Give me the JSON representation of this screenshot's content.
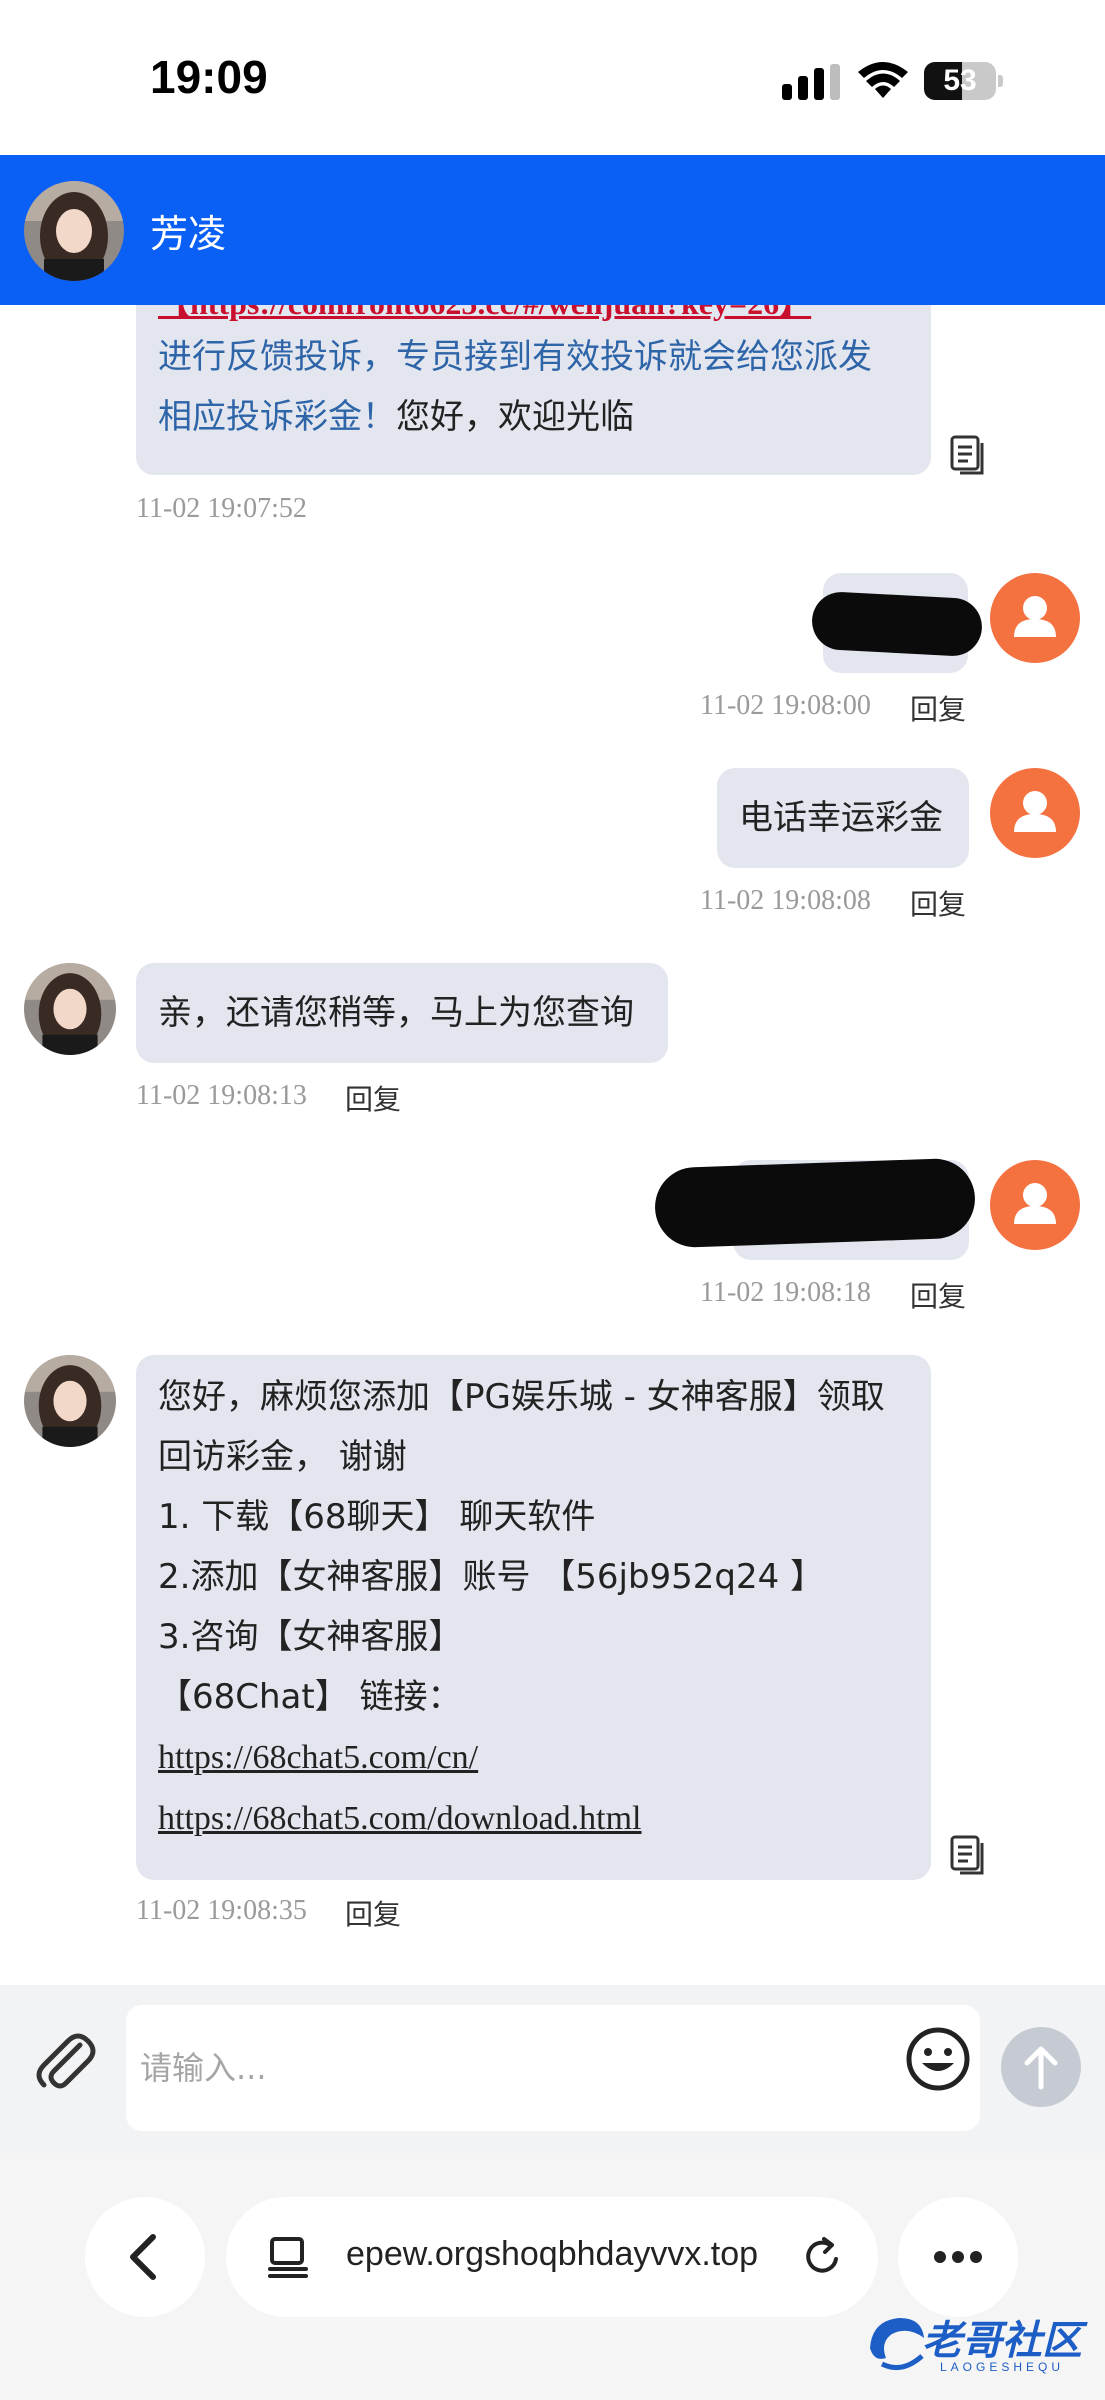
{
  "status_bar": {
    "time": "19:09",
    "battery": "53",
    "battery_level": 0.53
  },
  "header": {
    "agent_name": "芳凌"
  },
  "messages": [
    {
      "side": "left",
      "partial_link": "【https://comfront6625.cc/#/wenjuan?key=26】",
      "blue_text_1": "进行反馈投诉，专员接到有效投诉就会给您派发",
      "blue_text_2": "相应投诉彩金！",
      "plain_text": "您好，欢迎光临",
      "time": "11-02 19:07:52"
    },
    {
      "side": "right",
      "redacted": true,
      "time": "11-02 19:08:00",
      "reply": "回复"
    },
    {
      "side": "right",
      "text": "电话幸运彩金",
      "time": "11-02 19:08:08",
      "reply": "回复"
    },
    {
      "side": "left",
      "text": "亲，还请您稍等，马上为您查询",
      "time": "11-02 19:08:13",
      "reply": "回复"
    },
    {
      "side": "right",
      "redacted": true,
      "time": "11-02 19:08:18",
      "reply": "回复"
    },
    {
      "side": "left",
      "lines": [
        "您好，麻烦您添加【PG娱乐城 - 女神客服】领取",
        "回访彩金， 谢谢",
        "1. 下载【68聊天】 聊天软件",
        "2.添加【女神客服】账号 【56jb952q24 】",
        "3.咨询【女神客服】",
        "【68Chat】 链接："
      ],
      "links": [
        "https://68chat5.com/cn/",
        "https://68chat5.com/download.html"
      ],
      "time": "11-02 19:08:35",
      "reply": "回复"
    }
  ],
  "composer": {
    "placeholder": "请输入..."
  },
  "browser": {
    "url": "epew.orgshoqbhdayvvx.top"
  },
  "watermark": {
    "text": "老哥社区",
    "sub": "LAOGESHEQU"
  },
  "colors": {
    "header_blue": "#0a5ff5",
    "user_avatar": "#f47140",
    "bubble": "#e3e6ee"
  }
}
